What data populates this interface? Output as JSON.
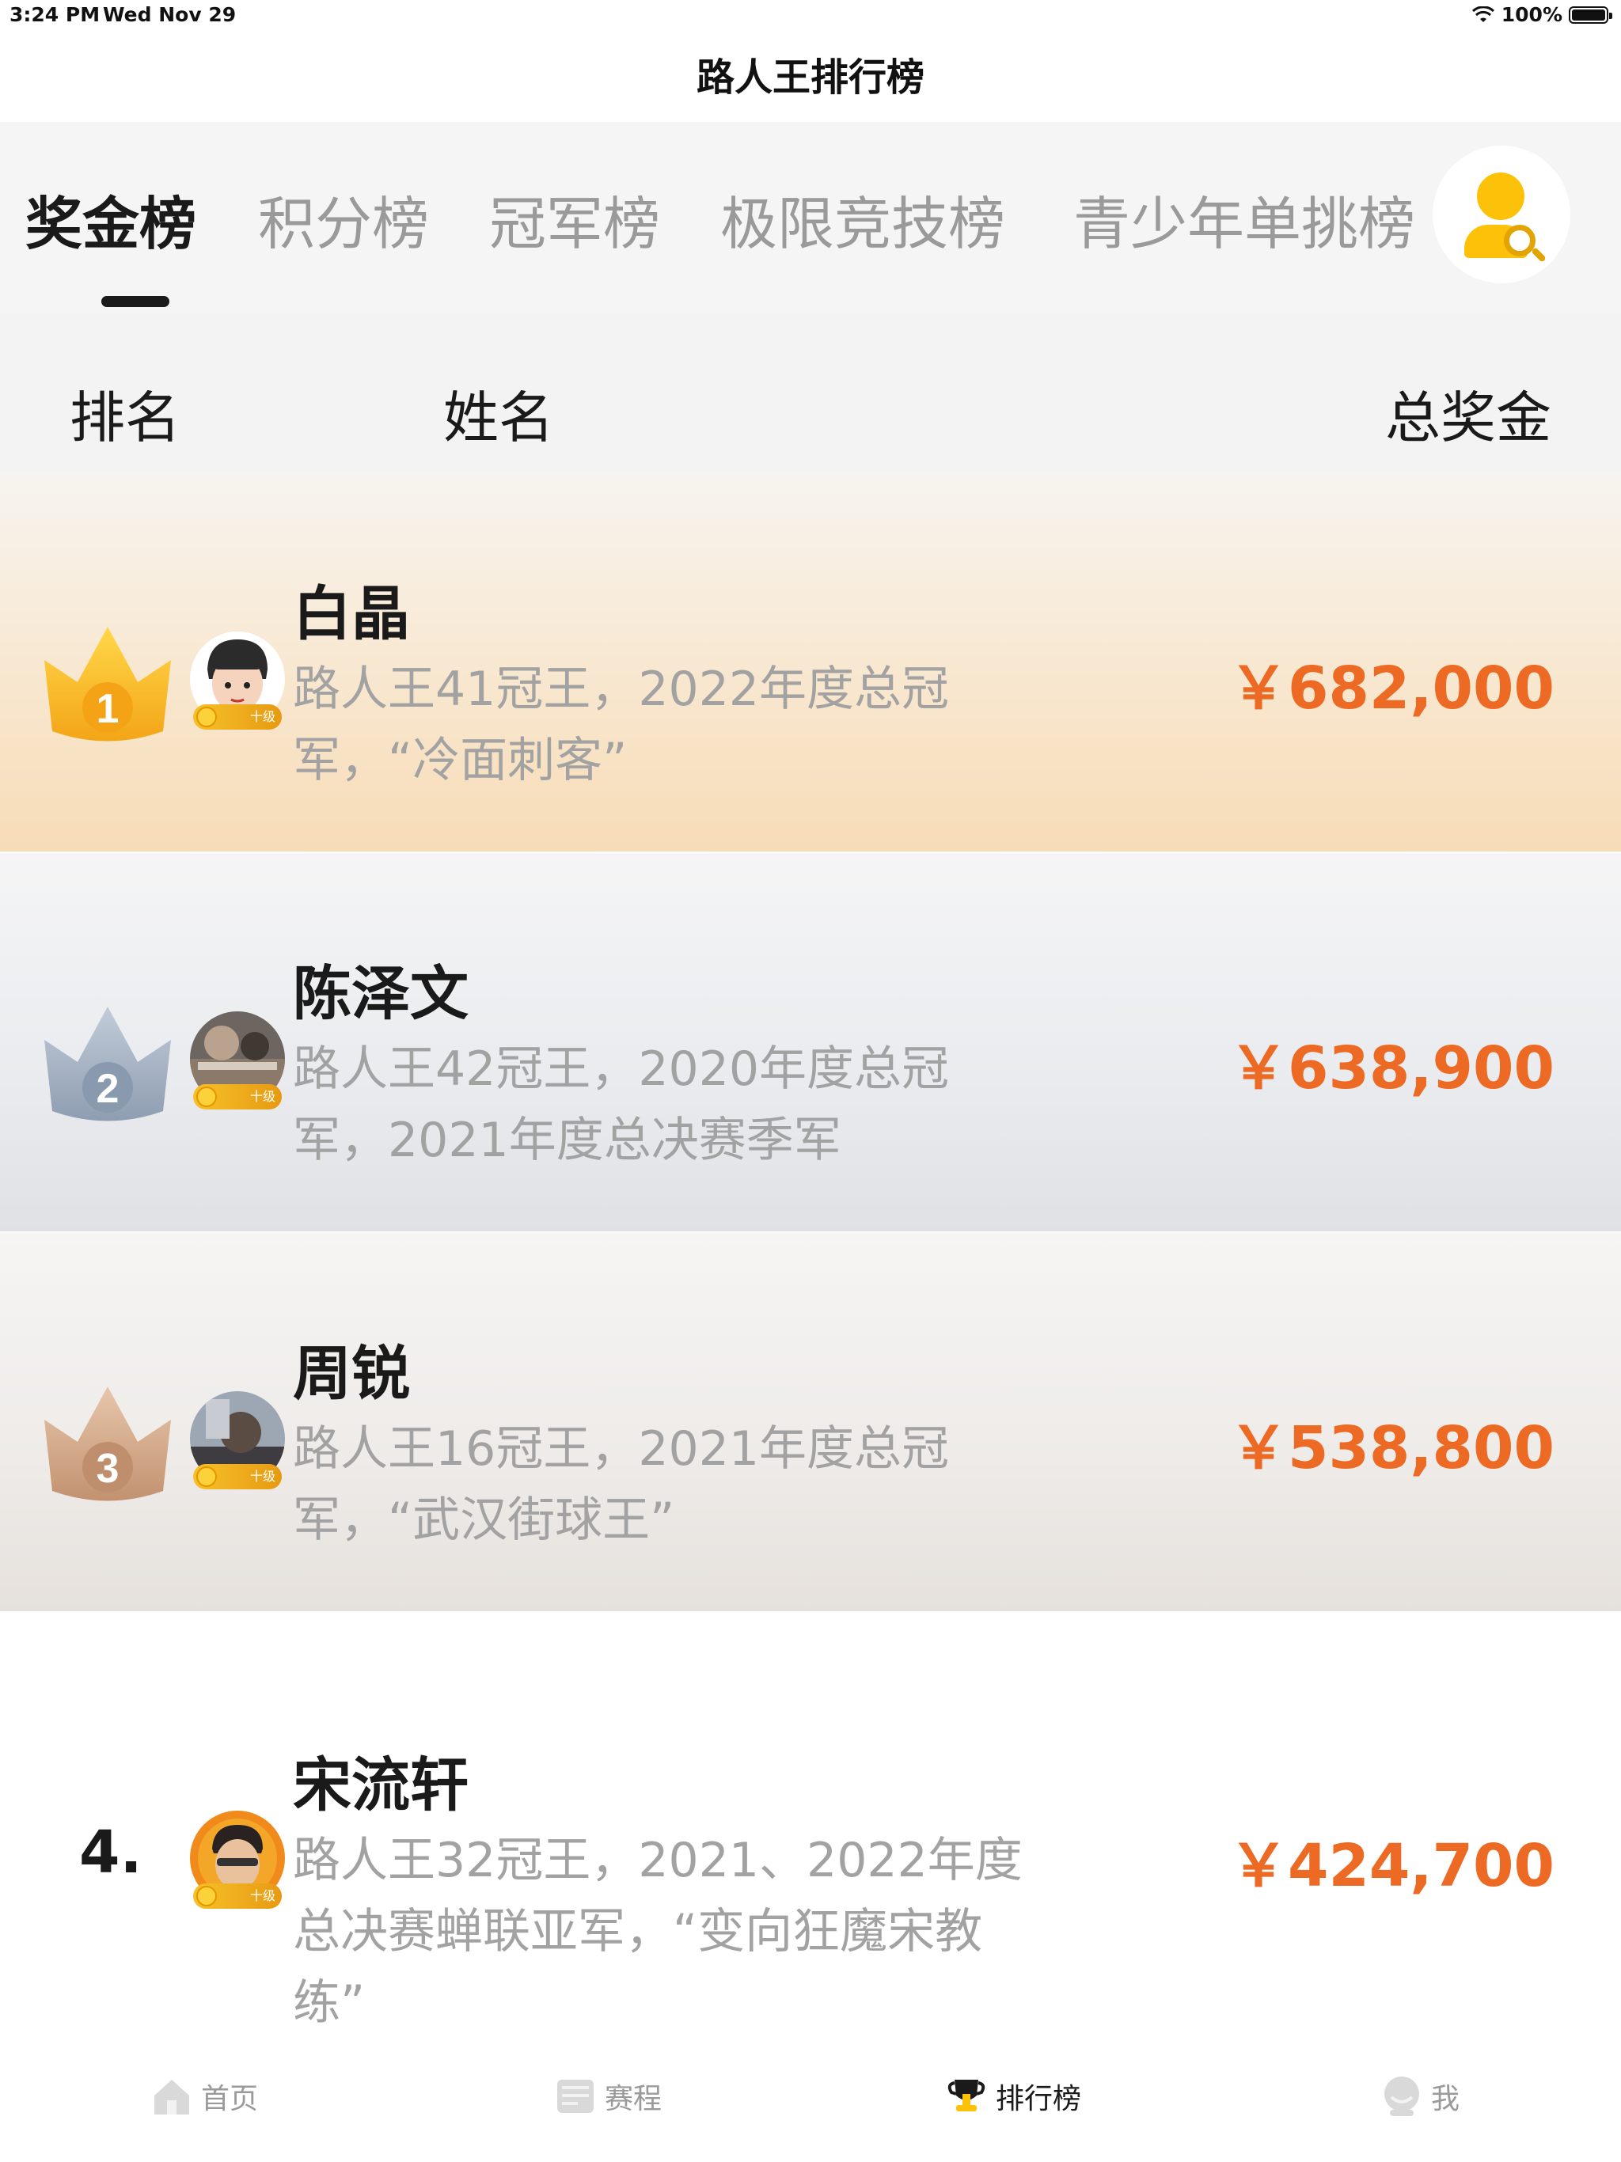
{
  "status_bar": {
    "time": "3:24 PM",
    "date": "Wed Nov 29",
    "battery": "100%"
  },
  "nav": {
    "title": "路人王排行榜"
  },
  "tabs": [
    "奖金榜",
    "积分榜",
    "冠军榜",
    "极限竞技榜",
    "青少年单挑榜"
  ],
  "active_tab": 0,
  "columns": {
    "rank": "排名",
    "name": "姓名",
    "prize": "总奖金"
  },
  "players": [
    {
      "rank": "1",
      "name": "白晶",
      "desc": "路人王41冠王，2022年度总冠军，“冷面刺客”",
      "prize": "￥682,000",
      "badge": "十级"
    },
    {
      "rank": "2",
      "name": "陈泽文",
      "desc": "路人王42冠王，2020年度总冠军，2021年度总决赛季军",
      "prize": "￥638,900",
      "badge": "十级"
    },
    {
      "rank": "3",
      "name": "周锐",
      "desc": "路人王16冠王，2021年度总冠军，“武汉街球王”",
      "prize": "￥538,800",
      "badge": "十级"
    },
    {
      "rank": "4.",
      "name": "宋流轩",
      "desc": "路人王32冠王，2021、2022年度总决赛蝉联亚军，“变向狂魔宋教练”",
      "prize": "￥424,700",
      "badge": "十级"
    }
  ],
  "bottom_nav": [
    {
      "label": "首页",
      "icon": "home-icon"
    },
    {
      "label": "赛程",
      "icon": "schedule-icon"
    },
    {
      "label": "排行榜",
      "icon": "trophy-icon"
    },
    {
      "label": "我",
      "icon": "profile-icon"
    }
  ],
  "colors": {
    "accent": "#ec6a24",
    "gold": "#fdc10a",
    "silver": "#a7b3c6",
    "bronze": "#d7ad8d"
  }
}
